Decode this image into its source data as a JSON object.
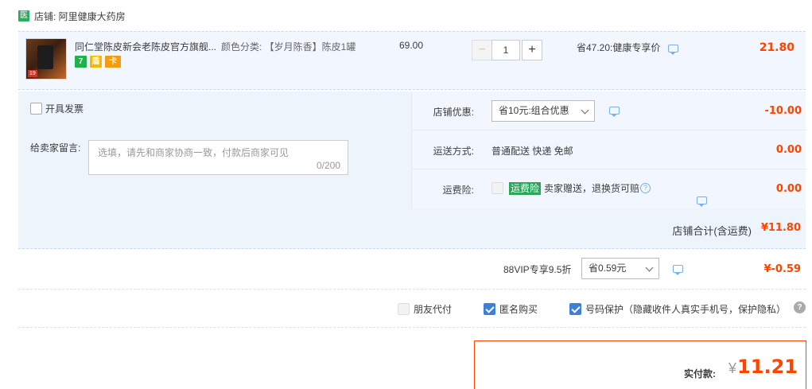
{
  "shop": {
    "badge": "医",
    "name": "店铺: 阿里健康大药房"
  },
  "item": {
    "thumb_tag": "19",
    "title": "同仁堂陈皮新会老陈皮官方旗舰...",
    "sku": "颜色分类: 【岁月陈香】陈皮1罐",
    "icons": [
      "7",
      "盾",
      "卡"
    ],
    "unit_price": "69.00",
    "quantity": "1",
    "minus": "−",
    "plus": "+",
    "discount_label": "省47.20:健康专享价",
    "total": "21.80"
  },
  "invoice": {
    "label": "开具发票"
  },
  "message": {
    "label": "给卖家留言:",
    "placeholder": "选填，请先和商家协商一致，付款后商家可见",
    "count": "0/200"
  },
  "shop_discount": {
    "label": "店铺优惠:",
    "selected": "省10元:组合优惠",
    "amount": "-10.00"
  },
  "shipping": {
    "label": "运送方式:",
    "value": "普通配送 快递 免邮",
    "amount": "0.00"
  },
  "insurance": {
    "label": "运费险:",
    "badge": "运费险",
    "value": "卖家赠送，退换货可赔",
    "help": "?",
    "amount": "0.00"
  },
  "shop_total": {
    "label": "店铺合计(含运费)",
    "value": "¥11.80"
  },
  "vip": {
    "label": "88VIP专享9.5折",
    "selected": "省0.59元",
    "amount": "¥-0.59"
  },
  "options": {
    "friend_pay": "朋友代付",
    "anonymous": "匿名购买",
    "number_protect": "号码保护（隐藏收件人真实手机号，保护隐私）",
    "help": "?"
  },
  "payment": {
    "label": "实付款:",
    "currency": "¥",
    "amount": "11.21"
  },
  "colors": {
    "accent_red": "#ff4400",
    "checkbox_blue": "#3e7fd8",
    "panel_bg": "#f2f7ff",
    "badge_green": "#27ae60"
  }
}
